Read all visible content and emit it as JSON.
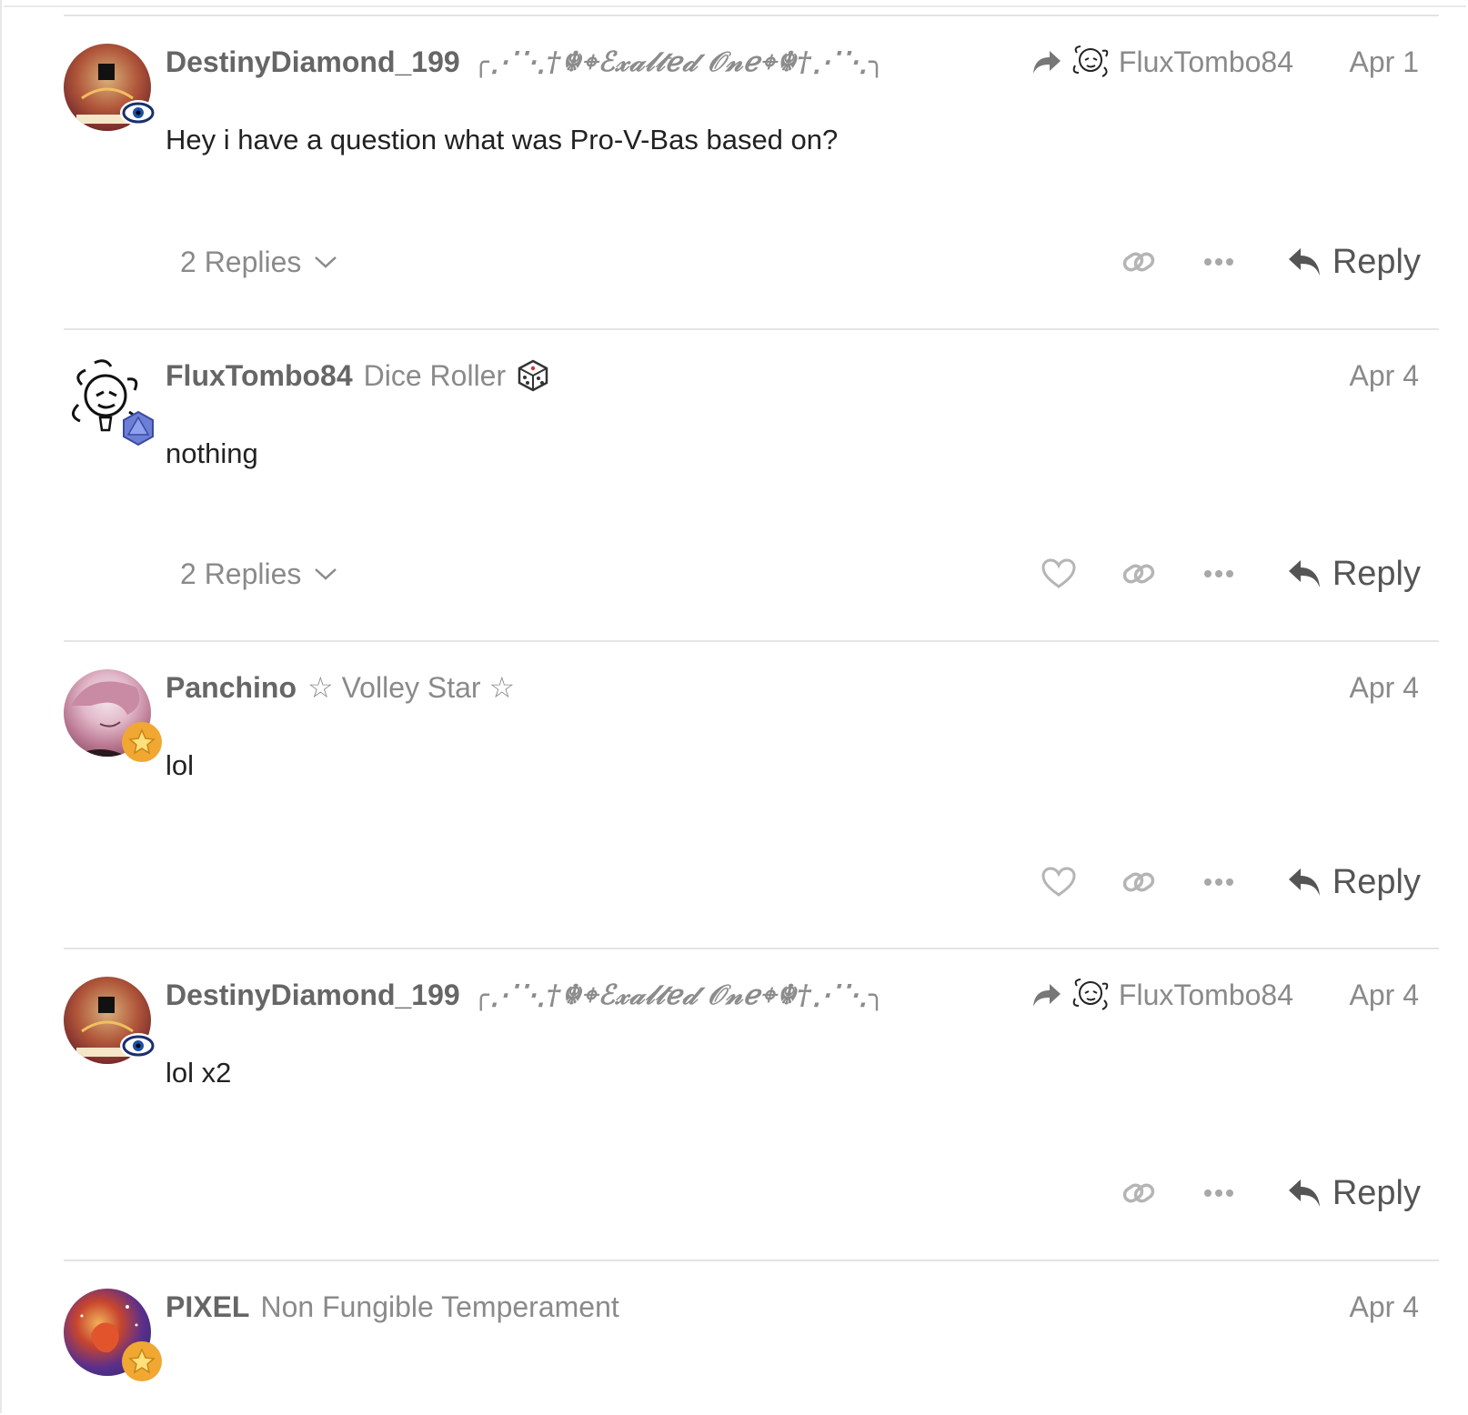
{
  "posts": [
    {
      "username": "DestinyDiamond_199",
      "user_title": "╭⋰⋱†☬⌖ℰ𝓍𝒶𝓁𝓉ℯ𝒹 𝒪𝓃ℯ⌖☬†⋰⋱╮",
      "reply_to": "FluxTombo84",
      "date": "Apr 1",
      "body": "Hey i have a question what was Pro-V-Bas based on?",
      "replies_label": "2 Replies",
      "reply_label": "Reply"
    },
    {
      "username": "FluxTombo84",
      "user_title": "Dice Roller",
      "date": "Apr 4",
      "body": "nothing",
      "replies_label": "2 Replies",
      "reply_label": "Reply"
    },
    {
      "username": "Panchino",
      "user_title": "☆ Volley Star ☆",
      "date": "Apr 4",
      "body": "lol",
      "reply_label": "Reply"
    },
    {
      "username": "DestinyDiamond_199",
      "user_title": "╭⋰⋱†☬⌖ℰ𝓍𝒶𝓁𝓉ℯ𝒹 𝒪𝓃ℯ⌖☬†⋰⋱╮",
      "reply_to": "FluxTombo84",
      "date": "Apr 4",
      "body": "lol x2",
      "reply_label": "Reply"
    },
    {
      "username": "PIXEL",
      "user_title": "Non Fungible Temperament",
      "date": "Apr 4"
    }
  ],
  "icons": {
    "reply_to": "share-arrow-icon",
    "link": "link-icon",
    "more": "more-dots-icon",
    "like": "heart-icon",
    "reply": "reply-arrow-icon",
    "chevron": "chevron-down-icon",
    "dice": "dice-icon"
  },
  "colors": {
    "muted": "#8a8a8a",
    "name": "#666666",
    "body": "#222222",
    "divider": "#e4e4e4"
  }
}
